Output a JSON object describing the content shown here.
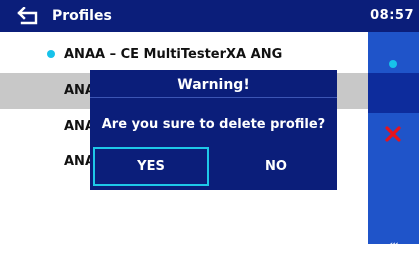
{
  "header": {
    "title": "Profiles",
    "time": "08:57",
    "back_icon": "back-arrow-icon"
  },
  "profiles": [
    {
      "label": "ANAA – CE MultiTesterXA ANG",
      "active_marker": true,
      "highlighted": false
    },
    {
      "label": "ANA",
      "active_marker": false,
      "highlighted": true
    },
    {
      "label": "ANA",
      "active_marker": false,
      "highlighted": false
    },
    {
      "label": "ANA",
      "active_marker": false,
      "highlighted": false
    }
  ],
  "sidebar": {
    "select_icon": "dot-icon",
    "delete_icon": "x-icon",
    "more_label": "‹‹‹"
  },
  "dialog": {
    "title": "Warning!",
    "message": "Are you sure to delete profile?",
    "yes_label": "YES",
    "no_label": "NO"
  },
  "colors": {
    "header_bg": "#0b1e7a",
    "sidebar_bg": "#1f54c9",
    "accent": "#17c2ea",
    "delete": "#e8131b",
    "highlight_row": "#c8c8c8"
  }
}
